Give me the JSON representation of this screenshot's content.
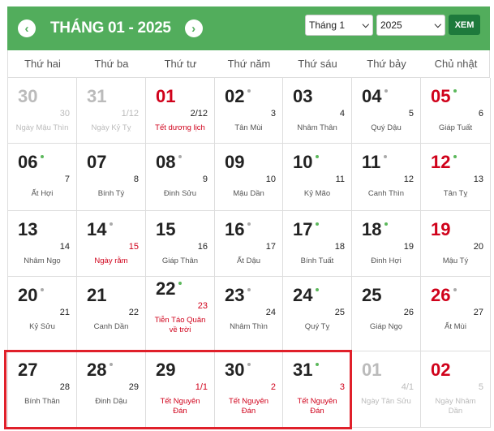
{
  "header": {
    "title": "THÁNG 01 - 2025",
    "prev_icon": "chevron-left",
    "next_icon": "chevron-right",
    "month_select": "Tháng 1",
    "year_select": "2025",
    "view_button": "XEM",
    "color": "#52ad5c"
  },
  "weekdays": [
    "Thứ hai",
    "Thứ ba",
    "Thứ tư",
    "Thứ năm",
    "Thứ sáu",
    "Thứ bảy",
    "Chủ nhật"
  ],
  "colors": {
    "dot_gray": "#aaaaaa",
    "dot_green": "#5cb85c",
    "red": "#d0021b",
    "highlight": "#e0202a"
  },
  "days": [
    {
      "d": "30",
      "l": "30",
      "n": "Ngày Mậu Thìn",
      "other": true
    },
    {
      "d": "31",
      "l": "1/12",
      "n": "Ngày Kỷ Tỵ",
      "other": true
    },
    {
      "d": "01",
      "l": "2/12",
      "n": "Tết dương lịch",
      "red_day": true,
      "red_name": true
    },
    {
      "d": "02",
      "l": "3",
      "n": "Tân Mùi",
      "dot": "gray"
    },
    {
      "d": "03",
      "l": "4",
      "n": "Nhâm Thân"
    },
    {
      "d": "04",
      "l": "5",
      "n": "Quý Dậu",
      "dot": "gray"
    },
    {
      "d": "05",
      "l": "6",
      "n": "Giáp Tuất",
      "dot": "green",
      "red_day": true
    },
    {
      "d": "06",
      "l": "7",
      "n": "Ất Hợi",
      "dot": "green"
    },
    {
      "d": "07",
      "l": "8",
      "n": "Bính Tý"
    },
    {
      "d": "08",
      "l": "9",
      "n": "Đinh Sửu",
      "dot": "gray"
    },
    {
      "d": "09",
      "l": "10",
      "n": "Mậu Dần"
    },
    {
      "d": "10",
      "l": "11",
      "n": "Kỷ Mão",
      "dot": "green"
    },
    {
      "d": "11",
      "l": "12",
      "n": "Canh Thìn",
      "dot": "gray"
    },
    {
      "d": "12",
      "l": "13",
      "n": "Tân Tỵ",
      "dot": "green",
      "red_day": true
    },
    {
      "d": "13",
      "l": "14",
      "n": "Nhâm Ngọ"
    },
    {
      "d": "14",
      "l": "15",
      "n": "Ngày rằm",
      "dot": "gray",
      "red_lunar": true,
      "red_name": true
    },
    {
      "d": "15",
      "l": "16",
      "n": "Giáp Thân"
    },
    {
      "d": "16",
      "l": "17",
      "n": "Ất Dậu",
      "dot": "gray"
    },
    {
      "d": "17",
      "l": "18",
      "n": "Bính Tuất",
      "dot": "green"
    },
    {
      "d": "18",
      "l": "19",
      "n": "Đinh Hợi",
      "dot": "green"
    },
    {
      "d": "19",
      "l": "20",
      "n": "Mậu Tý",
      "red_day": true
    },
    {
      "d": "20",
      "l": "21",
      "n": "Kỷ Sửu",
      "dot": "gray"
    },
    {
      "d": "21",
      "l": "22",
      "n": "Canh Dần"
    },
    {
      "d": "22",
      "l": "23",
      "n": "Tiễn Táo Quân về trời",
      "dot": "green",
      "red_lunar": true,
      "red_name": true
    },
    {
      "d": "23",
      "l": "24",
      "n": "Nhâm Thìn",
      "dot": "gray"
    },
    {
      "d": "24",
      "l": "25",
      "n": "Quý Tỵ",
      "dot": "green"
    },
    {
      "d": "25",
      "l": "26",
      "n": "Giáp Ngọ"
    },
    {
      "d": "26",
      "l": "27",
      "n": "Ất Mùi",
      "dot": "gray",
      "red_day": true
    },
    {
      "d": "27",
      "l": "28",
      "n": "Bính Thân"
    },
    {
      "d": "28",
      "l": "29",
      "n": "Đinh Dậu",
      "dot": "gray"
    },
    {
      "d": "29",
      "l": "1/1",
      "n": "Tết Nguyên Đán",
      "red_lunar": true,
      "red_name": true
    },
    {
      "d": "30",
      "l": "2",
      "n": "Tết Nguyên Đán",
      "dot": "gray",
      "red_lunar": true,
      "red_name": true
    },
    {
      "d": "31",
      "l": "3",
      "n": "Tết Nguyên Đán",
      "dot": "green",
      "red_lunar": true,
      "red_name": true
    },
    {
      "d": "01",
      "l": "4/1",
      "n": "Ngày Tân Sửu",
      "other": true
    },
    {
      "d": "02",
      "l": "5",
      "n": "Ngày Nhâm Dần",
      "other": true,
      "red_day": true
    }
  ]
}
